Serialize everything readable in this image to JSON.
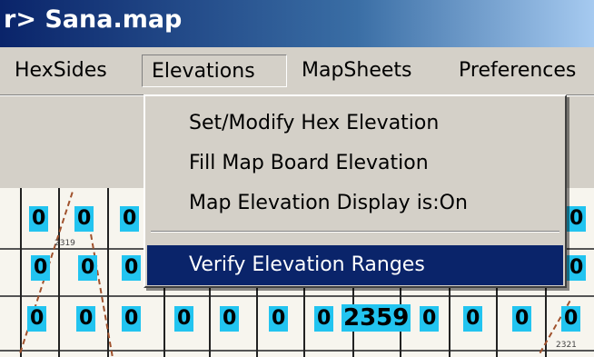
{
  "window": {
    "title": "r> Sana.map"
  },
  "menubar": {
    "items": [
      {
        "label": "HexSides"
      },
      {
        "label": "Elevations"
      },
      {
        "label": "MapSheets"
      },
      {
        "label": "Preferences"
      }
    ]
  },
  "elevations_menu": {
    "items": [
      {
        "label": "Set/Modify Hex Elevation"
      },
      {
        "label": "Fill Map Board Elevation"
      },
      {
        "label": "Map Elevation Display is:On"
      },
      {
        "label": "Verify Elevation Ranges"
      }
    ],
    "selected": "Verify Elevation Ranges"
  },
  "map": {
    "row1": [
      "0",
      "0",
      "0",
      "0"
    ],
    "row2": [
      "0",
      "0",
      "0",
      "0"
    ],
    "row3": [
      "0",
      "0",
      "0",
      "0",
      "0",
      "0",
      "0",
      "0",
      "0",
      "0",
      "0"
    ],
    "highlight_value": "2359",
    "small_labels": [
      "2319",
      "2321"
    ]
  },
  "colors": {
    "titlebar_start": "#0a246a",
    "menu_highlight": "#0a246a",
    "elevation_label_bg": "#22c4f0"
  }
}
